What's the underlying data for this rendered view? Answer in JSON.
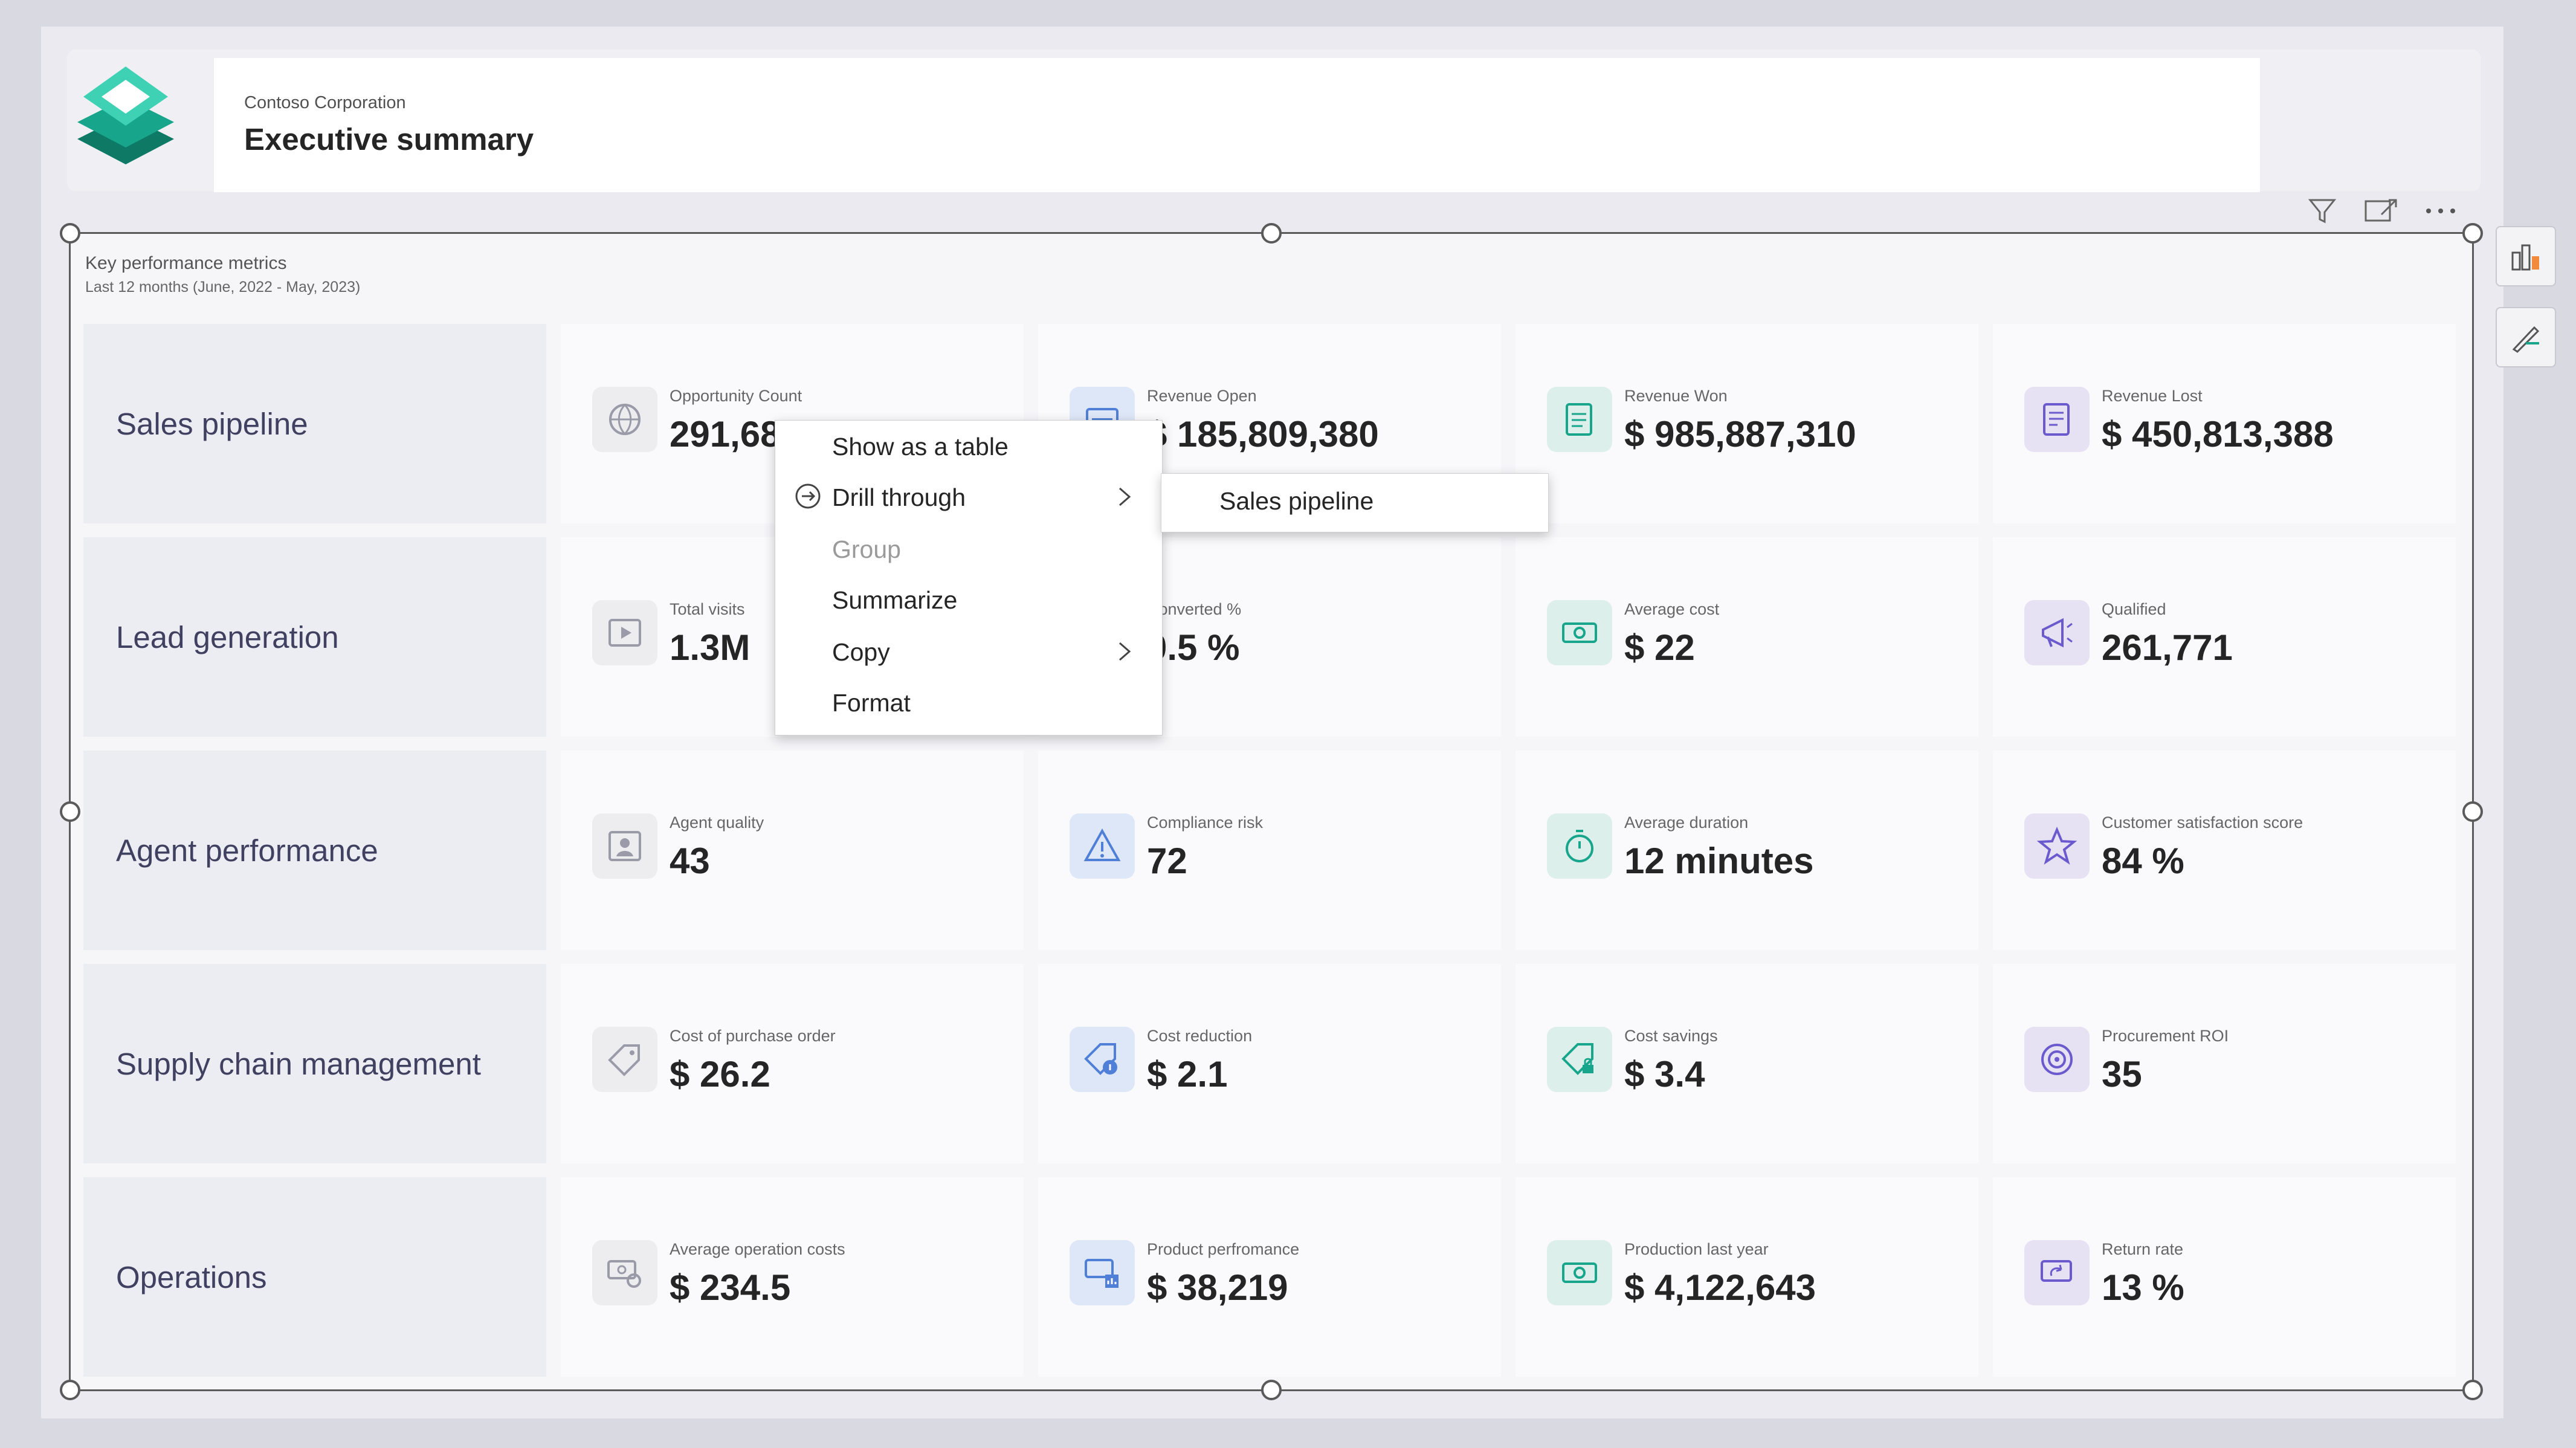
{
  "colors": {
    "accent_teal": "#17a58c",
    "accent_blue": "#4f7fd6",
    "accent_purple": "#6a5acd",
    "text_dark": "#252525",
    "row_label_text": "#404060"
  },
  "header": {
    "company": "Contoso Corporation",
    "title": "Executive summary",
    "logo": "contoso-diamond-logo"
  },
  "visual": {
    "title": "Key performance metrics",
    "subtitle": "Last 12 months (June, 2022 -  May, 2023)",
    "toolbar": [
      "filter-icon",
      "focus-mode-icon",
      "more-options-icon"
    ]
  },
  "side_pane": [
    "build-visual-icon",
    "format-visual-icon"
  ],
  "rows": [
    {
      "label": "Sales pipeline",
      "kpis": [
        {
          "label": "Opportunity Count",
          "value": "291,68",
          "icon": "globe-network-icon",
          "tone": "gray"
        },
        {
          "label": "Revenue Open",
          "value": "$ 185,809,380",
          "icon": "money-card-icon",
          "tone": "blue"
        },
        {
          "label": "Revenue Won",
          "value": "$ 985,887,310",
          "icon": "checklist-icon",
          "tone": "green"
        },
        {
          "label": "Revenue Lost",
          "value": "$ 450,813,388",
          "icon": "receipt-icon",
          "tone": "purple"
        }
      ]
    },
    {
      "label": "Lead generation",
      "kpis": [
        {
          "label": "Total visits",
          "value": "1.3M",
          "icon": "play-video-icon",
          "tone": "gray"
        },
        {
          "label": "Converted %",
          "value": "0.5 %",
          "icon": "conversion-icon",
          "tone": "blue"
        },
        {
          "label": "Average cost",
          "value": "$ 22",
          "icon": "cash-icon",
          "tone": "green"
        },
        {
          "label": "Qualified",
          "value": "261,771",
          "icon": "megaphone-icon",
          "tone": "purple"
        }
      ]
    },
    {
      "label": "Agent performance",
      "kpis": [
        {
          "label": "Agent quality",
          "value": "43",
          "icon": "person-card-icon",
          "tone": "gray"
        },
        {
          "label": "Compliance risk",
          "value": "72",
          "icon": "warning-icon",
          "tone": "blue"
        },
        {
          "label": "Average duration",
          "value": "12 minutes",
          "icon": "stopwatch-icon",
          "tone": "green"
        },
        {
          "label": "Customer satisfaction score",
          "value": "84 %",
          "icon": "star-icon",
          "tone": "purple"
        }
      ]
    },
    {
      "label": "Supply chain management",
      "kpis": [
        {
          "label": "Cost of purchase order",
          "value": "$ 26.2",
          "icon": "price-tag-icon",
          "tone": "gray"
        },
        {
          "label": "Cost reduction",
          "value": "$ 2.1",
          "icon": "tag-info-icon",
          "tone": "blue"
        },
        {
          "label": "Cost savings",
          "value": "$ 3.4",
          "icon": "tag-lock-icon",
          "tone": "green"
        },
        {
          "label": "Procurement ROI",
          "value": "35",
          "icon": "target-icon",
          "tone": "purple"
        }
      ]
    },
    {
      "label": "Operations",
      "kpis": [
        {
          "label": "Average operation costs",
          "value": "$ 234.5",
          "icon": "money-gear-icon",
          "tone": "gray"
        },
        {
          "label": "Product perfromance",
          "value": "$ 38,219",
          "icon": "money-chart-icon",
          "tone": "blue"
        },
        {
          "label": "Production last year",
          "value": "$ 4,122,643",
          "icon": "cash-icon",
          "tone": "green"
        },
        {
          "label": "Return rate",
          "value": "13 %",
          "icon": "money-return-icon",
          "tone": "purple"
        }
      ]
    }
  ],
  "context_menu": {
    "items": [
      {
        "label": "Show as a table",
        "enabled": true
      },
      {
        "label": "Drill through",
        "enabled": true,
        "submenu": true,
        "icon": "drill-through-icon"
      },
      {
        "label": "Group",
        "enabled": false
      },
      {
        "label": "Summarize",
        "enabled": true
      },
      {
        "label": "Copy",
        "enabled": true,
        "submenu": true
      },
      {
        "label": "Format",
        "enabled": true
      }
    ],
    "submenu_item": "Sales pipeline"
  }
}
